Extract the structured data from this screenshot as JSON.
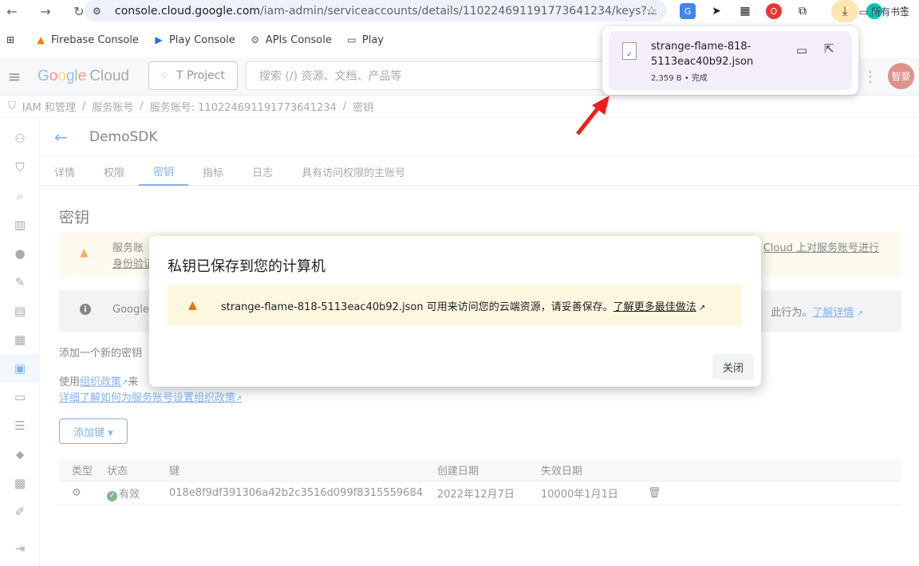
{
  "browser": {
    "url_host": "console.cloud.google.com",
    "url_path": "/iam-admin/serviceaccounts/details/110224691191773641234/keys?...",
    "bookmarks": [
      "Firebase Console",
      "Play Console",
      "APIs Console",
      "Play"
    ],
    "all_bookmarks": "所有书签"
  },
  "download": {
    "filename": "strange-flame-818-5113eac40b92.json",
    "meta": "2,359 B • 完成"
  },
  "header": {
    "logo_google": "Google",
    "logo_cloud": "Cloud",
    "project": "T Project",
    "search_placeholder": "搜索 (/) 资源、文档、产品等",
    "avatar": "智豪"
  },
  "breadcrumb": {
    "items": [
      "IAM 和管理",
      "服务账号",
      "服务账号: 110224691191773641234",
      "密钥"
    ]
  },
  "page": {
    "title": "DemoSDK",
    "tabs": [
      "详情",
      "权限",
      "密钥",
      "指标",
      "日志",
      "具有访问权限的主账号"
    ],
    "active_tab": "密钥",
    "section_title": "密钥",
    "warn_line1": "服务账",
    "warn_line2": "身份验证",
    "warn_right": "Cloud 上对服务账号进行",
    "info_left": "Google",
    "info_right": "此行为。",
    "info_link": "了解详情",
    "add_text": "添加一个新的密钥",
    "policy_prefix": "使用",
    "policy_link": "组织政策",
    "policy_suffix": "来",
    "policy_more": "详细了解如何为服务账号设置组织政策",
    "add_key_button": "添加键 ▾"
  },
  "table": {
    "headers": [
      "类型",
      "状态",
      "键",
      "创建日期",
      "失效日期"
    ],
    "rows": [
      {
        "status": "有效",
        "key": "018e8f9df391306a42b2c3516d099f8315559684",
        "created": "2022年12月7日",
        "expires": "10000年1月1日"
      }
    ]
  },
  "dialog": {
    "title": "私钥已保存到您的计算机",
    "message": "strange-flame-818-5113eac40b92.json 可用来访问您的云端资源，请妥善保存。",
    "link": "了解更多最佳做法",
    "close": "关闭"
  },
  "colors": {
    "accent": "#1a73e8",
    "warning_bg": "#fef7e0",
    "warning_icon": "#e37400",
    "download_bg": "#f4eefa"
  }
}
